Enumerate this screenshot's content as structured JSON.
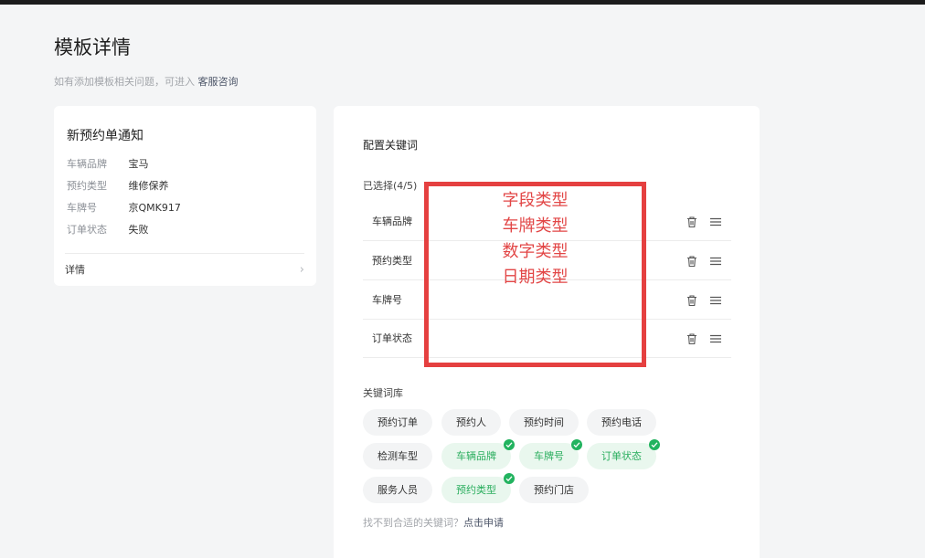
{
  "page": {
    "title": "模板详情",
    "subtitle_text": "如有添加模板相关问题，可进入",
    "subtitle_link": "客服咨询"
  },
  "preview": {
    "title": "新预约单通知",
    "fields": [
      {
        "label": "车辆品牌",
        "value": "宝马"
      },
      {
        "label": "预约类型",
        "value": "维修保养"
      },
      {
        "label": "车牌号",
        "value": "京QMK917"
      },
      {
        "label": "订单状态",
        "value": "失败"
      }
    ],
    "detail_label": "详情"
  },
  "config": {
    "title": "配置关键词",
    "selected_title": "已选择(4/5)",
    "selected": [
      "车辆品牌",
      "预约类型",
      "车牌号",
      "订单状态"
    ],
    "library_title": "关键词库",
    "library": [
      {
        "label": "预约订单",
        "selected": false
      },
      {
        "label": "预约人",
        "selected": false
      },
      {
        "label": "预约时间",
        "selected": false
      },
      {
        "label": "预约电话",
        "selected": false
      },
      {
        "label": "检测车型",
        "selected": false
      },
      {
        "label": "车辆品牌",
        "selected": true
      },
      {
        "label": "车牌号",
        "selected": true
      },
      {
        "label": "订单状态",
        "selected": true
      },
      {
        "label": "服务人员",
        "selected": false
      },
      {
        "label": "预约类型",
        "selected": true
      },
      {
        "label": "预约门店",
        "selected": false
      }
    ],
    "hint_text": "找不到合适的关键词？",
    "hint_link": "点击申请"
  },
  "annotation": {
    "lines": [
      "字段类型",
      "车牌类型",
      "数字类型",
      "日期类型"
    ]
  },
  "colors": {
    "accent_green": "#22b35f",
    "annotation_red": "#e54040",
    "link": "#4c5568"
  }
}
